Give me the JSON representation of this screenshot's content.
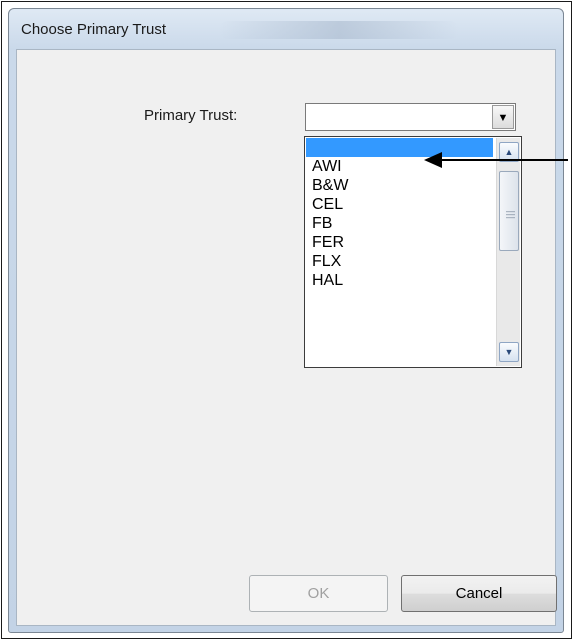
{
  "dialog": {
    "title": "Choose Primary Trust"
  },
  "primary_trust": {
    "label": "Primary Trust:",
    "value": "",
    "dropdown_arrow": "chevron-down-icon"
  },
  "dropdown": {
    "items": [
      "",
      "AWI",
      "B&W",
      "CEL",
      "FB",
      "FER",
      "FLX",
      "HAL"
    ],
    "selected_index": 0,
    "scroll_up_icon": "scroll-up-icon",
    "scroll_down_icon": "scroll-down-icon"
  },
  "buttons": {
    "ok_label": "OK",
    "cancel_label": "Cancel"
  },
  "colors": {
    "selection": "#3399ff",
    "client_bg": "#f0f0f0"
  }
}
